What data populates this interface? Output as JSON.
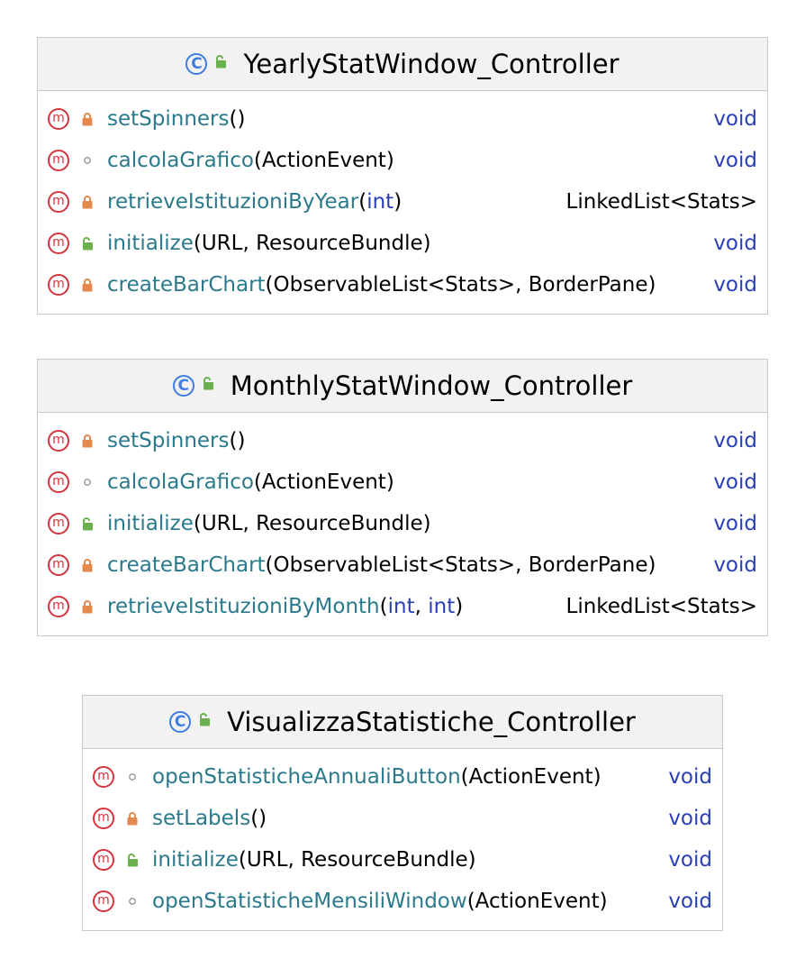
{
  "classes": [
    {
      "name": "YearlyStatWindow_Controller",
      "class_icon": "C",
      "methods": [
        {
          "visibility": "private",
          "name": "setSpinners",
          "params": "()",
          "return": "void"
        },
        {
          "visibility": "package",
          "name": "calcolaGrafico",
          "params": "(ActionEvent)",
          "return": "void"
        },
        {
          "visibility": "private",
          "name": "retrieveIstituzioniByYear",
          "params": "(int)",
          "return": "LinkedList<Stats>"
        },
        {
          "visibility": "public",
          "name": "initialize",
          "params": "(URL, ResourceBundle)",
          "return": "void"
        },
        {
          "visibility": "private",
          "name": "createBarChart",
          "params": "(ObservableList<Stats>, BorderPane)",
          "return": "void"
        }
      ]
    },
    {
      "name": "MonthlyStatWindow_Controller",
      "class_icon": "C",
      "methods": [
        {
          "visibility": "private",
          "name": "setSpinners",
          "params": "()",
          "return": "void"
        },
        {
          "visibility": "package",
          "name": "calcolaGrafico",
          "params": "(ActionEvent)",
          "return": "void"
        },
        {
          "visibility": "public",
          "name": "initialize",
          "params": "(URL, ResourceBundle)",
          "return": "void"
        },
        {
          "visibility": "private",
          "name": "createBarChart",
          "params": "(ObservableList<Stats>, BorderPane)",
          "return": "void"
        },
        {
          "visibility": "private",
          "name": "retrieveIstituzioniByMonth",
          "params": "(int, int)",
          "return": "LinkedList<Stats>"
        }
      ]
    },
    {
      "name": "VisualizzaStatistiche_Controller",
      "class_icon": "C",
      "methods": [
        {
          "visibility": "package",
          "name": "openStatisticheAnnualiButton",
          "params": "(ActionEvent)",
          "return": "void"
        },
        {
          "visibility": "private",
          "name": "setLabels",
          "params": "()",
          "return": "void"
        },
        {
          "visibility": "public",
          "name": "initialize",
          "params": "(URL, ResourceBundle)",
          "return": "void"
        },
        {
          "visibility": "package",
          "name": "openStatisticheMensiliWindow",
          "params": "(ActionEvent)",
          "return": "void"
        }
      ]
    }
  ],
  "method_icon": "m",
  "colors": {
    "class_icon": "#3f7de0",
    "method_icon": "#d3343d",
    "private_lock": "#e3894e",
    "public_unlock": "#6ab04c",
    "method_name": "#2a7a8c",
    "keyword": "#2b3fb5"
  }
}
